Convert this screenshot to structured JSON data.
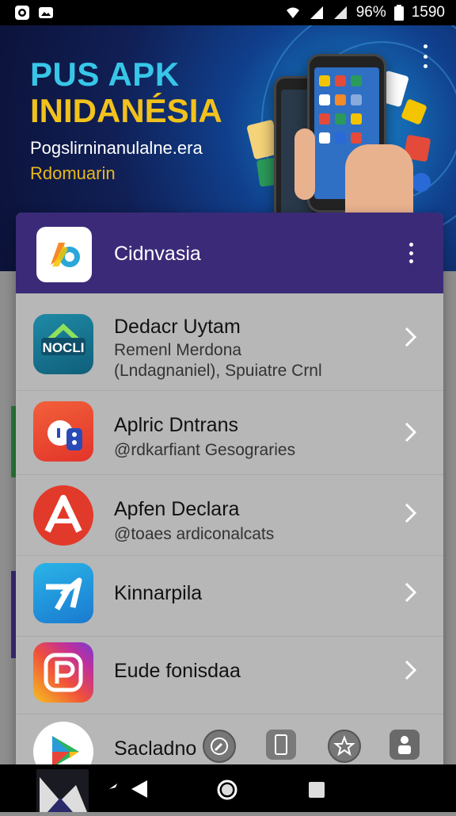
{
  "status_bar": {
    "battery": "96%",
    "time": "1590",
    "left_icons": [
      "circle-app-icon",
      "photo-icon"
    ],
    "right_icons": [
      "wifi-icon",
      "signal-icon",
      "signal-icon",
      "battery-icon"
    ]
  },
  "banner": {
    "title_line1": "PUS APK",
    "title_line2": "INIDANÉSIA",
    "subtitle_line1": "Pogslirninanulalne.era",
    "subtitle_line2": "Rdomuarin",
    "menu_icon": "more-vert-icon"
  },
  "card": {
    "header_title": "Cidnvasia",
    "header_menu_icon": "more-vert-icon",
    "rows": [
      {
        "title": "Dedacr Uytam",
        "sub1": "Remenl Merdona",
        "sub2": "(Lndagnaniel), Spuiatre Crnl",
        "icon": "noclu-app-icon"
      },
      {
        "title": "Aplric Dntrans",
        "sub1": "@rdkarfiant Gesograries",
        "icon": "chat-app-icon"
      },
      {
        "title": "Apfen Declara",
        "sub1": "@toaes ardiconalcats",
        "icon": "a-app-icon"
      },
      {
        "title": "Kinnarpila",
        "icon": "blue-swirl-app-icon"
      },
      {
        "title": "Eude fonisdaa",
        "icon": "instagram-like-app-icon"
      },
      {
        "title": "Sacladno",
        "icon": "play-store-icon"
      }
    ]
  },
  "bottom_actions": [
    "compass-icon",
    "phone-icon",
    "star-badge-icon",
    "person-icon"
  ],
  "nav": [
    "app-logo-icon",
    "back-icon",
    "home-icon",
    "recents-icon"
  ],
  "colors": {
    "header_purple": "#3b2a78",
    "banner_blue": "#103f8c",
    "title_cyan": "#37c6e8",
    "title_yellow": "#f2c21c"
  }
}
